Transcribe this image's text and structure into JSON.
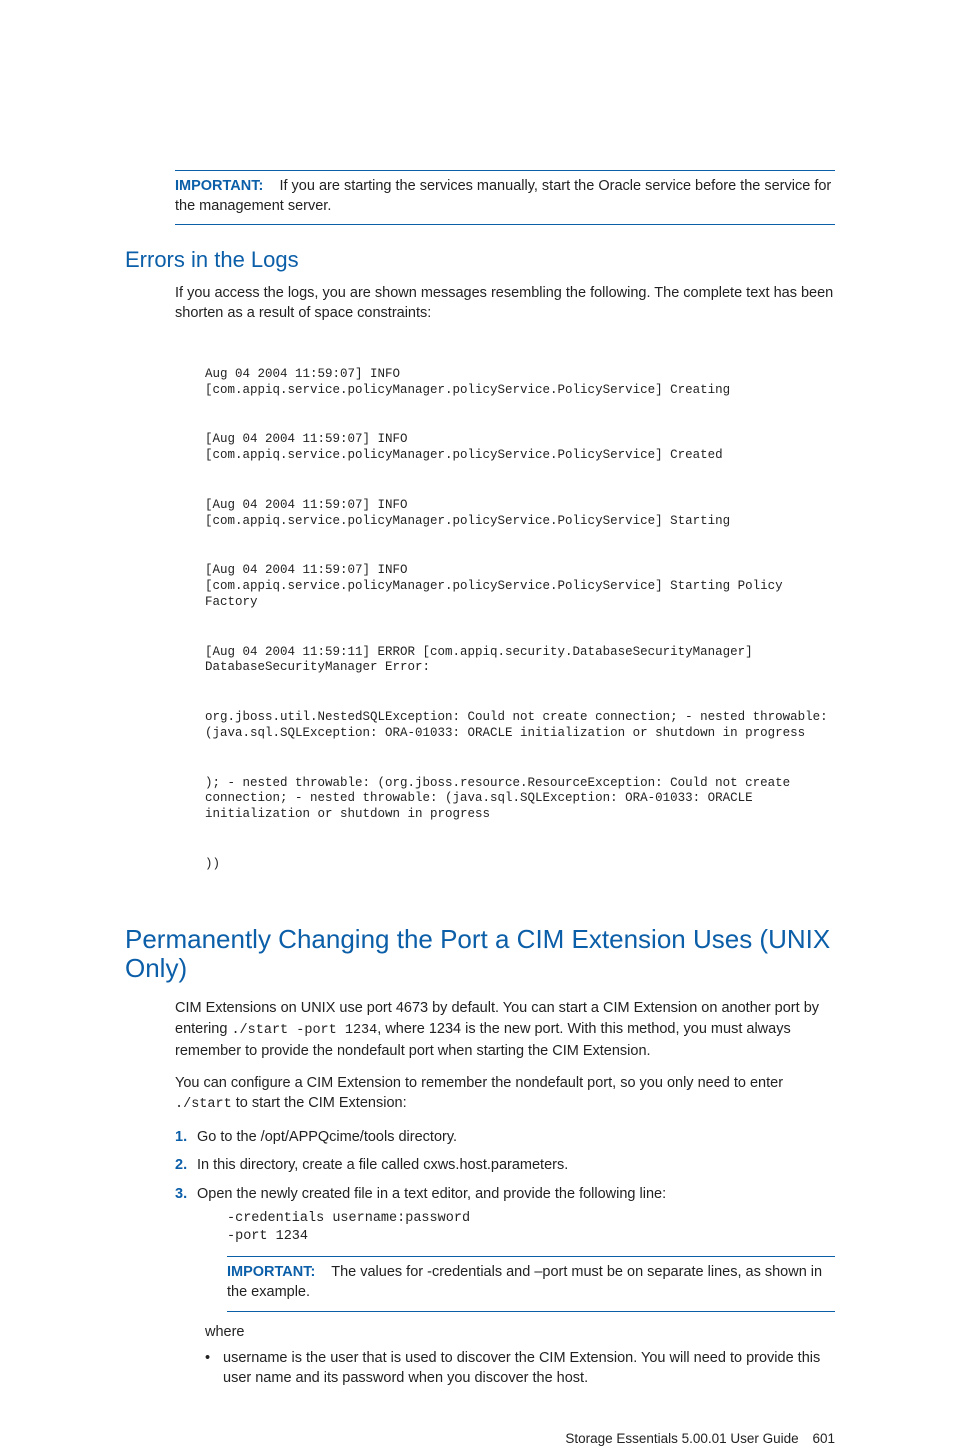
{
  "note1": {
    "label": "IMPORTANT:",
    "text": "If you are starting the services manually, start the Oracle service before the service for the management server."
  },
  "errors": {
    "heading": "Errors in the Logs",
    "intro": "If you access the logs, you are shown messages resembling the following. The complete text has been shorten as a result of space constraints:",
    "log": [
      "Aug 04 2004 11:59:07] INFO [com.appiq.service.policyManager.policyService.PolicyService] Creating",
      "[Aug 04 2004 11:59:07] INFO [com.appiq.service.policyManager.policyService.PolicyService] Created",
      "[Aug 04 2004 11:59:07] INFO [com.appiq.service.policyManager.policyService.PolicyService] Starting",
      "[Aug 04 2004 11:59:07] INFO [com.appiq.service.policyManager.policyService.PolicyService] Starting Policy Factory",
      "[Aug 04 2004 11:59:11] ERROR [com.appiq.security.DatabaseSecurityManager] DatabaseSecurityManager Error:",
      "org.jboss.util.NestedSQLException: Could not create connection; - nested throwable: (java.sql.SQLException: ORA-01033: ORACLE initialization or shutdown in progress",
      "); - nested throwable: (org.jboss.resource.ResourceException: Could not create connection; - nested throwable: (java.sql.SQLException: ORA-01033: ORACLE initialization or shutdown in progress",
      "))"
    ]
  },
  "port": {
    "heading": "Permanently Changing the Port a CIM Extension Uses (UNIX Only)",
    "p1_a": "CIM Extensions on UNIX use port 4673 by default. You can start a CIM Extension on another port by entering ",
    "p1_code": "./start -port 1234",
    "p1_b": ", where 1234 is the new port. With this method, you must always remember to provide the nondefault port when starting the CIM Extension.",
    "p2_a": "You can configure a CIM Extension to remember the nondefault port, so you only need to enter ",
    "p2_code": "./start",
    "p2_b": " to start the CIM Extension:",
    "steps": {
      "s1": "Go to the /opt/APPQcime/tools directory.",
      "s2": "In this directory, create a file called cxws.host.parameters.",
      "s3": "Open the newly created file in a text editor, and provide the following line:"
    },
    "code": "-credentials username:password\n-port 1234",
    "note": {
      "label": "IMPORTANT:",
      "text": "The values for -credentials and –port must be on separate lines, as shown in the example."
    },
    "where_label": "where",
    "bullet1": "username is the user that is used to discover the CIM Extension. You will need to provide this user name and its password when you discover the host."
  },
  "footer": {
    "title": "Storage Essentials 5.00.01 User Guide",
    "page": "601"
  }
}
